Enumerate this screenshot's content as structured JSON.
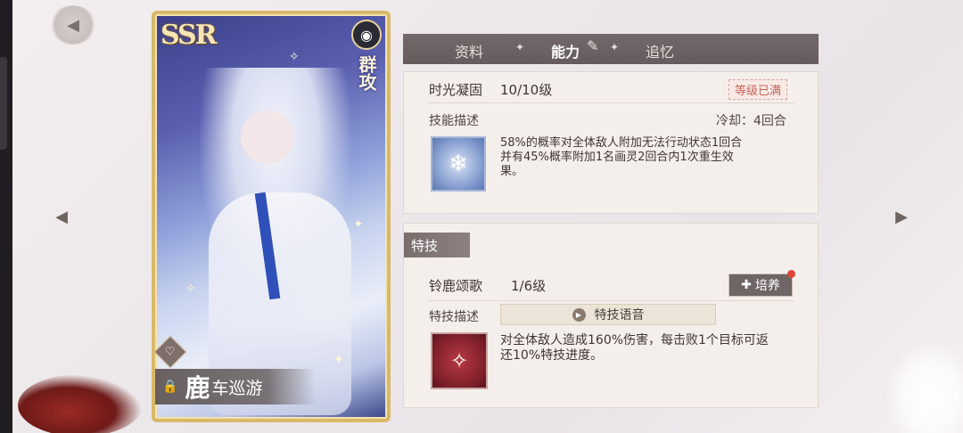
{
  "card": {
    "rarity": "SSR",
    "attack_type": "群攻",
    "name_big": "鹿",
    "name_small": "车巡游"
  },
  "tabs": [
    {
      "label": "资料",
      "active": false
    },
    {
      "label": "能力",
      "active": true
    },
    {
      "label": "追忆",
      "active": false
    }
  ],
  "skill": {
    "name": "时光凝固",
    "level": "10/10级",
    "max_badge": "等级已满",
    "desc_label": "技能描述",
    "cooldown": "冷却：4回合",
    "description_lines": [
      "58%的概率对全体敌人附加无法行动状态1回合",
      "并有45%概率附加1名画灵2回合内1次重生效",
      "果。"
    ]
  },
  "technique": {
    "header": "特技",
    "name": "铃鹿颂歌",
    "level": "1/6级",
    "train_label": "培养",
    "desc_label": "特技描述",
    "voice_label": "特技语音",
    "description_lines": [
      "对全体敌人造成160%伤害，每击败1个目标可返",
      "还10%特技进度。"
    ]
  },
  "colors": {
    "card_border": "#d9b868",
    "tab_bar": "#6c6162",
    "badge_text": "#c4665a",
    "red_dot": "#e0453a"
  }
}
